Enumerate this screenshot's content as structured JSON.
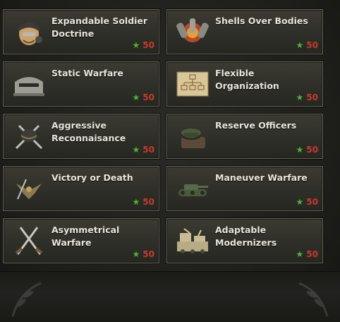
{
  "cards": [
    {
      "title": "Expandable Soldier Doctrine",
      "cost": "50",
      "icon": "soldier-head-icon"
    },
    {
      "title": "Shells Over Bodies",
      "cost": "50",
      "icon": "artillery-shells-icon"
    },
    {
      "title": "Static Warfare",
      "cost": "50",
      "icon": "bunker-icon"
    },
    {
      "title": "Flexible Organization",
      "cost": "50",
      "icon": "org-chart-icon"
    },
    {
      "title": "Aggressive Reconnaisance",
      "cost": "50",
      "icon": "crossed-swords-helmet-icon"
    },
    {
      "title": "Reserve Officers",
      "cost": "50",
      "icon": "officer-cap-icon"
    },
    {
      "title": "Victory or Death",
      "cost": "50",
      "icon": "eagle-icon"
    },
    {
      "title": "Maneuver Warfare",
      "cost": "50",
      "icon": "tank-icon"
    },
    {
      "title": "Asymmetrical Warfare",
      "cost": "50",
      "icon": "crossed-bayonets-icon"
    },
    {
      "title": "Adaptable Modernizers",
      "cost": "50",
      "icon": "vehicle-column-icon"
    }
  ],
  "colors": {
    "star": "#46b832",
    "cost": "#c83a2c",
    "title": "#e8e6dc"
  }
}
